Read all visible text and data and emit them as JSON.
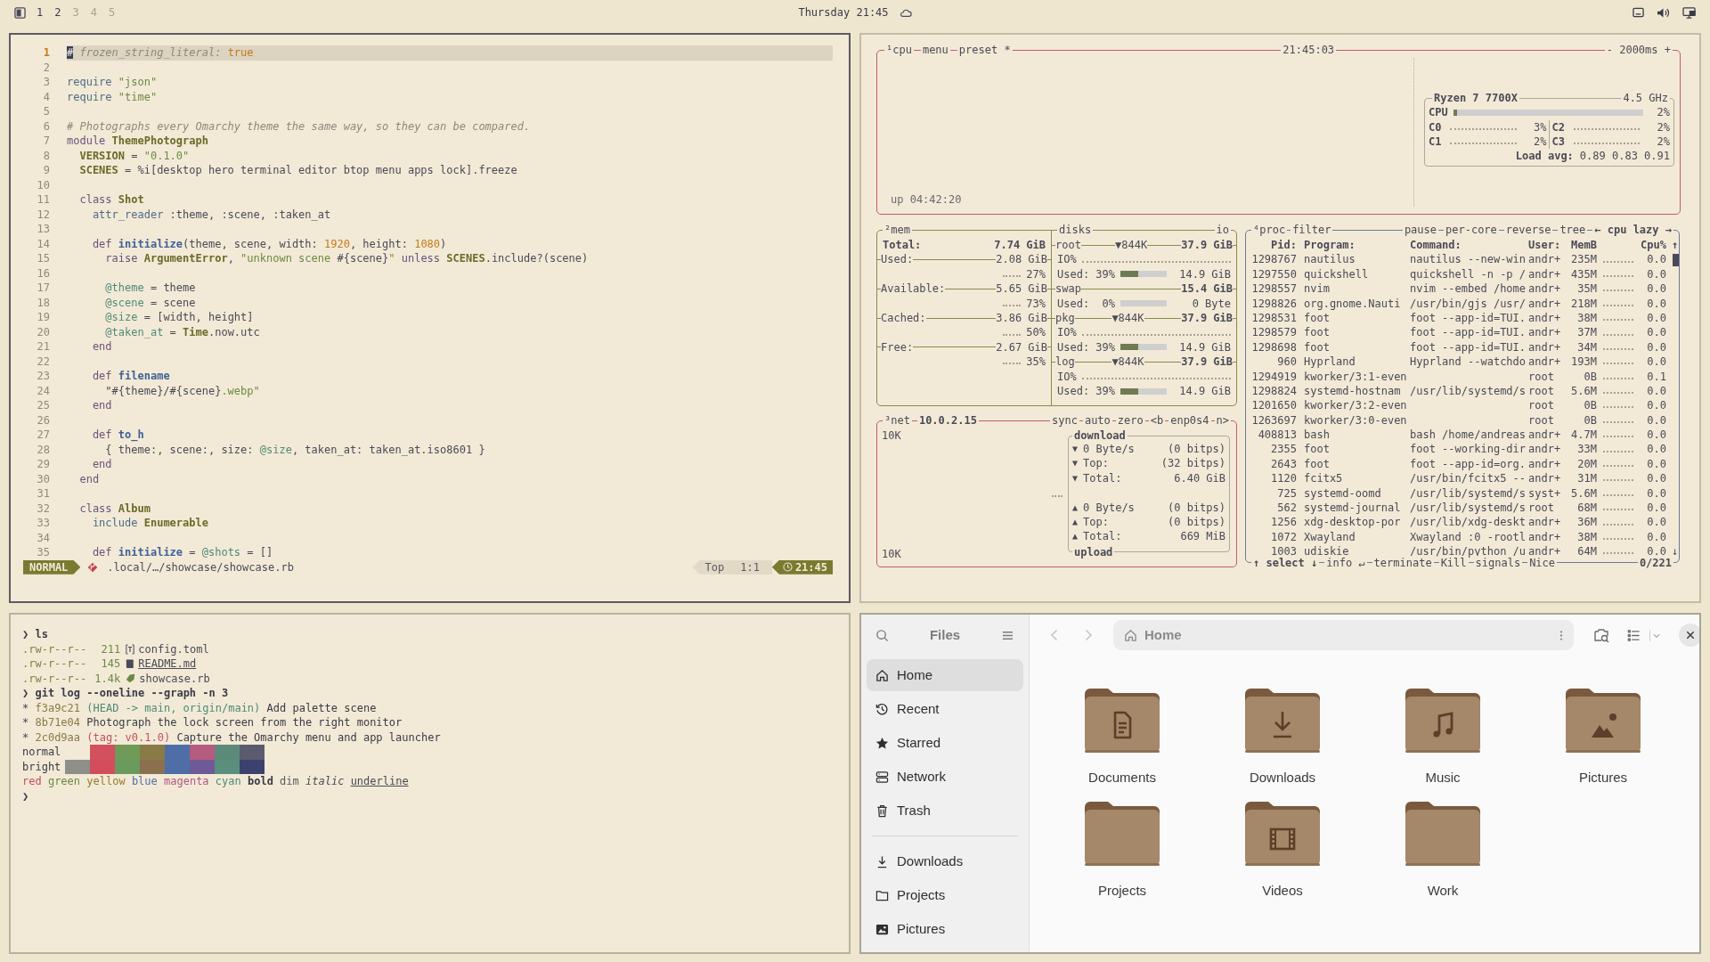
{
  "top_bar": {
    "workspaces": [
      {
        "label": "1",
        "occupied": true
      },
      {
        "label": "2",
        "occupied": true
      },
      {
        "label": "3",
        "occupied": false
      },
      {
        "label": "4",
        "occupied": false
      },
      {
        "label": "5",
        "occupied": false
      }
    ],
    "clock": "Thursday 21:45"
  },
  "editor": {
    "lines": [
      {
        "number": "1",
        "selected": true,
        "segments": [
          {
            "text": "#",
            "kind": "cursor"
          },
          {
            "text": " frozen_string_literal: ",
            "kind": "comment"
          },
          {
            "text": "true",
            "kind": "number"
          }
        ]
      },
      {
        "number": "2",
        "selected": false
      },
      {
        "number": "3",
        "selected": false,
        "segments": [
          {
            "text": "require",
            "kind": "builtin"
          },
          {
            "text": " \"json\"",
            "kind": "string"
          }
        ]
      },
      {
        "number": "4",
        "selected": false,
        "segments": [
          {
            "text": "require",
            "kind": "builtin"
          },
          {
            "text": " \"time\"",
            "kind": "string"
          }
        ]
      },
      {
        "number": "5",
        "selected": false
      },
      {
        "number": "6",
        "selected": false,
        "segments": [
          {
            "text": "# Photographs every Omarchy theme the same way, so they can be compared.",
            "kind": "comment"
          }
        ]
      },
      {
        "number": "7",
        "selected": false,
        "segments": [
          {
            "text": "module",
            "kind": "keyword"
          },
          {
            "text": " ThemePhotograph",
            "kind": "const"
          }
        ]
      },
      {
        "number": "8",
        "selected": false,
        "segments": [
          {
            "text": "  VERSION",
            "kind": "const"
          },
          {
            "text": " = ",
            "kind": "plain"
          },
          {
            "text": "\"0.1.0\"",
            "kind": "string"
          }
        ]
      },
      {
        "number": "9",
        "selected": false,
        "segments": [
          {
            "text": "  SCENES",
            "kind": "const"
          },
          {
            "text": " = %i[desktop hero terminal editor btop menu apps lock].freeze",
            "kind": "plain"
          }
        ]
      },
      {
        "number": "10",
        "selected": false
      },
      {
        "number": "11",
        "selected": false,
        "segments": [
          {
            "text": "  class",
            "kind": "keyword"
          },
          {
            "text": " Shot",
            "kind": "const"
          }
        ]
      },
      {
        "number": "12",
        "selected": false,
        "segments": [
          {
            "text": "    attr_reader",
            "kind": "builtin"
          },
          {
            "text": " :theme, :scene, :taken_at",
            "kind": "plain"
          }
        ]
      },
      {
        "number": "13",
        "selected": false
      },
      {
        "number": "14",
        "selected": false,
        "segments": [
          {
            "text": "    def",
            "kind": "keyword"
          },
          {
            "text": " initialize",
            "kind": "func"
          },
          {
            "text": "(theme, scene, width: ",
            "kind": "plain"
          },
          {
            "text": "1920",
            "kind": "number"
          },
          {
            "text": ", height: ",
            "kind": "plain"
          },
          {
            "text": "1080",
            "kind": "number"
          },
          {
            "text": ")",
            "kind": "plain"
          }
        ]
      },
      {
        "number": "15",
        "selected": false,
        "segments": [
          {
            "text": "      raise",
            "kind": "keyword"
          },
          {
            "text": " ArgumentError",
            "kind": "const"
          },
          {
            "text": ", ",
            "kind": "plain"
          },
          {
            "text": "\"unknown scene ",
            "kind": "string"
          },
          {
            "text": "#{scene}",
            "kind": "plain"
          },
          {
            "text": "\"",
            "kind": "string"
          },
          {
            "text": " unless",
            "kind": "keyword"
          },
          {
            "text": " SCENES",
            "kind": "const"
          },
          {
            "text": ".include?(scene)",
            "kind": "plain"
          }
        ]
      },
      {
        "number": "16",
        "selected": false
      },
      {
        "number": "17",
        "selected": false,
        "segments": [
          {
            "text": "      @theme",
            "kind": "ivar"
          },
          {
            "text": " = theme",
            "kind": "plain"
          }
        ]
      },
      {
        "number": "18",
        "selected": false,
        "segments": [
          {
            "text": "      @scene",
            "kind": "ivar"
          },
          {
            "text": " = scene",
            "kind": "plain"
          }
        ]
      },
      {
        "number": "19",
        "selected": false,
        "segments": [
          {
            "text": "      @size",
            "kind": "ivar"
          },
          {
            "text": " = [width, height]",
            "kind": "plain"
          }
        ]
      },
      {
        "number": "20",
        "selected": false,
        "segments": [
          {
            "text": "      @taken_at",
            "kind": "ivar"
          },
          {
            "text": " = ",
            "kind": "plain"
          },
          {
            "text": "Time",
            "kind": "const"
          },
          {
            "text": ".now.utc",
            "kind": "plain"
          }
        ]
      },
      {
        "number": "21",
        "selected": false,
        "segments": [
          {
            "text": "    end",
            "kind": "keyword"
          }
        ]
      },
      {
        "number": "22",
        "selected": false
      },
      {
        "number": "23",
        "selected": false,
        "segments": [
          {
            "text": "    def",
            "kind": "keyword"
          },
          {
            "text": " filename",
            "kind": "func"
          }
        ]
      },
      {
        "number": "24",
        "selected": false,
        "segments": [
          {
            "text": "      \"#{theme}/#{scene}",
            "kind": "plain"
          },
          {
            "text": ".webp\"",
            "kind": "string"
          }
        ]
      },
      {
        "number": "25",
        "selected": false,
        "segments": [
          {
            "text": "    end",
            "kind": "keyword"
          }
        ]
      },
      {
        "number": "26",
        "selected": false
      },
      {
        "number": "27",
        "selected": false,
        "segments": [
          {
            "text": "    def",
            "kind": "keyword"
          },
          {
            "text": " to_h",
            "kind": "func"
          }
        ]
      },
      {
        "number": "28",
        "selected": false,
        "segments": [
          {
            "text": "      { theme:, scene:, size: ",
            "kind": "plain"
          },
          {
            "text": "@size",
            "kind": "ivar"
          },
          {
            "text": ", taken_at: taken_at.iso8601 }",
            "kind": "plain"
          }
        ]
      },
      {
        "number": "29",
        "selected": false,
        "segments": [
          {
            "text": "    end",
            "kind": "keyword"
          }
        ]
      },
      {
        "number": "30",
        "selected": false,
        "segments": [
          {
            "text": "  end",
            "kind": "keyword"
          }
        ]
      },
      {
        "number": "31",
        "selected": false
      },
      {
        "number": "32",
        "selected": false,
        "segments": [
          {
            "text": "  class",
            "kind": "keyword"
          },
          {
            "text": " Album",
            "kind": "const"
          }
        ]
      },
      {
        "number": "33",
        "selected": false,
        "segments": [
          {
            "text": "    include",
            "kind": "builtin"
          },
          {
            "text": " Enumerable",
            "kind": "const"
          }
        ]
      },
      {
        "number": "34",
        "selected": false
      },
      {
        "number": "35",
        "selected": false,
        "segments": [
          {
            "text": "    def",
            "kind": "keyword"
          },
          {
            "text": " initialize",
            "kind": "func"
          },
          {
            "text": " = ",
            "kind": "plain"
          },
          {
            "text": "@shots",
            "kind": "ivar"
          },
          {
            "text": " = []",
            "kind": "plain"
          }
        ]
      }
    ],
    "status": {
      "mode": "NORMAL",
      "file": ".local/…/showcase/showcase.rb",
      "position": "Top",
      "cursor": "1:1",
      "time": "21:45"
    }
  },
  "terminal": {
    "lines": [
      {
        "kind": "prompt",
        "prompt": "❯",
        "command": "ls"
      },
      {
        "kind": "file",
        "perms": ".rw-r--r--",
        "size": "211",
        "name": "config.toml",
        "underline": false
      },
      {
        "kind": "file",
        "perms": ".rw-r--r--",
        "size": "145",
        "name": "README.md",
        "underline": true
      },
      {
        "kind": "file",
        "perms": ".rw-r--r--",
        "size": "1.4k",
        "name": "showcase.rb",
        "underline": false
      },
      {
        "kind": "prompt",
        "prompt": "❯",
        "command": "git log --oneline --graph -n 3"
      },
      {
        "kind": "commit",
        "graph": "*",
        "hash": "f3a9c21",
        "refs": {
          "text": "(HEAD -> main, origin/main)",
          "kind": "branch"
        },
        "message": "Add palette scene"
      },
      {
        "kind": "commit",
        "graph": "*",
        "hash": "8b71e04",
        "message": "Photograph the lock screen from the right monitor"
      },
      {
        "kind": "commit",
        "graph": "*",
        "hash": "2c0d9aa",
        "refs": {
          "text": "(tag: v0.1.0)",
          "kind": "tag"
        },
        "message": "Capture the Omarchy menu and app launcher"
      },
      {
        "kind": "palette",
        "label": "normal",
        "swatches": [
          {
            "color": "#d3505f"
          },
          {
            "color": "#6f9a58"
          },
          {
            "color": "#8a7a45"
          },
          {
            "color": "#4f6ea8"
          },
          {
            "color": "#b45b7f"
          },
          {
            "color": "#5b8a7b"
          },
          {
            "color": "#5a5b6e"
          }
        ]
      },
      {
        "kind": "palette",
        "label": "bright",
        "swatches": [
          {
            "color": "#8f8f8a"
          },
          {
            "color": "#d44d5c"
          },
          {
            "color": "#6b9a5f"
          },
          {
            "color": "#8b7050"
          },
          {
            "color": "#4f6ea8"
          },
          {
            "color": "#6e5a96"
          },
          {
            "color": "#5a8f7e"
          },
          {
            "color": "#3d4170"
          }
        ]
      },
      {
        "kind": "styles",
        "words": [
          {
            "text": "red",
            "kind": "red"
          },
          {
            "text": "green",
            "kind": "green"
          },
          {
            "text": "yellow",
            "kind": "yellow"
          },
          {
            "text": "blue",
            "kind": "blue"
          },
          {
            "text": "magenta",
            "kind": "magenta"
          },
          {
            "text": "cyan",
            "kind": "cyan"
          },
          {
            "text": "bold",
            "kind": "bold"
          },
          {
            "text": "dim",
            "kind": "dim"
          },
          {
            "text": "italic",
            "kind": "italic"
          },
          {
            "text": "underline",
            "kind": "underline"
          }
        ]
      },
      {
        "kind": "prompt",
        "prompt": "❯"
      }
    ]
  },
  "btop": {
    "cpu": {
      "tabs": [
        "¹cpu",
        "menu",
        "preset *"
      ],
      "clock": "21:45:03",
      "interval": "- 2000ms +",
      "uptime": "up 04:42:20",
      "model": "Ryzen 7 7700X",
      "frequency": "4.5 GHz",
      "total": {
        "label": "CPU",
        "level": 0.02,
        "value": "2%"
      },
      "cores": [
        {
          "label": "C0",
          "value": "3%"
        },
        {
          "label": "C1",
          "value": "2%"
        },
        {
          "label": "C2",
          "value": "2%"
        },
        {
          "label": "C3",
          "value": "2%"
        }
      ],
      "load_label": "Load avg:",
      "load": "0.89 0.83 0.91"
    },
    "memory": {
      "title": "²mem",
      "total": {
        "label": "Total:",
        "value": "7.74 GiB"
      },
      "rows": [
        {
          "label": "Used:",
          "value": "2.08 GiB",
          "percent": "27%"
        },
        {
          "label": "Available:",
          "value": "5.65 GiB",
          "percent": "73%"
        },
        {
          "label": "Cached:",
          "value": "3.86 GiB",
          "percent": "50%"
        },
        {
          "label": "Free:",
          "value": "2.67 GiB",
          "percent": "35%"
        }
      ]
    },
    "disks": {
      "title": "disks",
      "io_title": "io",
      "items": [
        {
          "name": "root",
          "io": "▼844K",
          "size": "37.9 GiB",
          "io_label": "IO%",
          "used": "Used: 39%",
          "level": 0.39,
          "used_size": "14.9 GiB"
        },
        {
          "name": "swap",
          "size": "15.4 GiB",
          "used": "Used:  0%",
          "level": 0,
          "used_size": "0 Byte"
        },
        {
          "name": "pkg",
          "io": "▼844K",
          "size": "37.9 GiB",
          "io_label": "IO%",
          "used": "Used: 39%",
          "level": 0.39,
          "used_size": "14.9 GiB"
        },
        {
          "name": "log",
          "io": "▼844K",
          "size": "37.9 GiB",
          "io_label": "IO%",
          "used": "Used: 39%",
          "level": 0.39,
          "used_size": "14.9 GiB"
        }
      ]
    },
    "net": {
      "title": "³net",
      "address": "10.0.2.15",
      "options": [
        "sync",
        "auto",
        "zero",
        "<b",
        "enp0s4",
        "n>"
      ],
      "scale_top": "10K",
      "scale_bottom": "10K",
      "download": {
        "title": "download",
        "rows": [
          {
            "arrow": "▼",
            "label": "0 Byte/s",
            "value": "(0 bitps)"
          },
          {
            "arrow": "▼",
            "label": "Top:",
            "value": "(32 bitps)"
          },
          {
            "arrow": "▼",
            "label": "Total:",
            "value": "6.40 GiB"
          }
        ]
      },
      "upload": {
        "title": "upload",
        "rows": [
          {
            "arrow": "▲",
            "label": "0 Byte/s",
            "value": "(0 bitps)"
          },
          {
            "arrow": "▲",
            "label": "Top:",
            "value": "(0 bitps)"
          },
          {
            "arrow": "▲",
            "label": "Total:",
            "value": "669 MiB"
          }
        ]
      }
    },
    "proc": {
      "title": "⁴proc",
      "filter": "filter",
      "options": [
        "pause",
        "per-core",
        "reverse",
        "tree"
      ],
      "sort": "← cpu lazy →",
      "columns": [
        "Pid:",
        "Program:",
        "Command:",
        "User:",
        "MemB",
        "Cpu%"
      ],
      "scroll_up": "↑",
      "scroll_down": "↓",
      "rows": [
        {
          "pid": "1298767",
          "program": "nautilus",
          "command": "nautilus --new-win",
          "user": "andr+",
          "mem": "235M",
          "cpu": "0.0"
        },
        {
          "pid": "1297550",
          "program": "quickshell",
          "command": "quickshell -n -p /",
          "user": "andr+",
          "mem": "435M",
          "cpu": "0.0"
        },
        {
          "pid": "1298557",
          "program": "nvim",
          "command": "nvim --embed /home",
          "user": "andr+",
          "mem": "35M",
          "cpu": "0.0"
        },
        {
          "pid": "1298826",
          "program": "org.gnome.Nauti",
          "command": "/usr/bin/gjs /usr/",
          "user": "andr+",
          "mem": "218M",
          "cpu": "0.0"
        },
        {
          "pid": "1298531",
          "program": "foot",
          "command": "foot --app-id=TUI.",
          "user": "andr+",
          "mem": "38M",
          "cpu": "0.0"
        },
        {
          "pid": "1298579",
          "program": "foot",
          "command": "foot --app-id=TUI.",
          "user": "andr+",
          "mem": "37M",
          "cpu": "0.0"
        },
        {
          "pid": "1298698",
          "program": "foot",
          "command": "foot --app-id=TUI.",
          "user": "andr+",
          "mem": "34M",
          "cpu": "0.0"
        },
        {
          "pid": "960",
          "program": "Hyprland",
          "command": "Hyprland --watchdo",
          "user": "andr+",
          "mem": "193M",
          "cpu": "0.0"
        },
        {
          "pid": "1294919",
          "program": "kworker/3:1-even",
          "user": "root",
          "mem": "0B",
          "cpu": "0.1"
        },
        {
          "pid": "1298824",
          "program": "systemd-hostnam",
          "command": "/usr/lib/systemd/s",
          "user": "root",
          "mem": "5.6M",
          "cpu": "0.0"
        },
        {
          "pid": "1201650",
          "program": "kworker/3:2-even",
          "user": "root",
          "mem": "0B",
          "cpu": "0.0"
        },
        {
          "pid": "1263697",
          "program": "kworker/3:0-even",
          "user": "root",
          "mem": "0B",
          "cpu": "0.0"
        },
        {
          "pid": "408813",
          "program": "bash",
          "command": "bash /home/andreas",
          "user": "andr+",
          "mem": "4.7M",
          "cpu": "0.0"
        },
        {
          "pid": "2355",
          "program": "foot",
          "command": "foot --working-dir",
          "user": "andr+",
          "mem": "33M",
          "cpu": "0.0"
        },
        {
          "pid": "2643",
          "program": "foot",
          "command": "foot --app-id=org.",
          "user": "andr+",
          "mem": "20M",
          "cpu": "0.0"
        },
        {
          "pid": "1120",
          "program": "fcitx5",
          "command": "/usr/bin/fcitx5 --",
          "user": "andr+",
          "mem": "31M",
          "cpu": "0.0"
        },
        {
          "pid": "725",
          "program": "systemd-oomd",
          "command": "/usr/lib/systemd/s",
          "user": "syst+",
          "mem": "5.6M",
          "cpu": "0.0"
        },
        {
          "pid": "562",
          "program": "systemd-journal",
          "command": "/usr/lib/systemd/s",
          "user": "root",
          "mem": "68M",
          "cpu": "0.0"
        },
        {
          "pid": "1256",
          "program": "xdg-desktop-por",
          "command": "/usr/lib/xdg-deskt",
          "user": "andr+",
          "mem": "36M",
          "cpu": "0.0"
        },
        {
          "pid": "1072",
          "program": "Xwayland",
          "command": "Xwayland :0 -rootl",
          "user": "andr+",
          "mem": "38M",
          "cpu": "0.0"
        },
        {
          "pid": "1003",
          "program": "udiskie",
          "command": "/usr/bin/python /u",
          "user": "andr+",
          "mem": "64M",
          "cpu": "0.0"
        }
      ],
      "footer": [
        "↑ select ↓",
        "info ↵",
        "terminate",
        "Kill",
        "signals",
        "Nice"
      ],
      "count": "0/221"
    }
  },
  "files": {
    "title": "Files",
    "places": [
      {
        "label": "Home",
        "kind": "home",
        "selected": true
      },
      {
        "label": "Recent",
        "kind": "clock",
        "selected": false
      },
      {
        "label": "Starred",
        "kind": "star",
        "selected": false
      },
      {
        "label": "Network",
        "kind": "network",
        "selected": false
      },
      {
        "label": "Trash",
        "kind": "trash",
        "selected": false
      }
    ],
    "bookmarks": [
      {
        "label": "Downloads",
        "kind": "download",
        "selected": false
      },
      {
        "label": "Projects",
        "kind": "folder",
        "selected": false
      },
      {
        "label": "Pictures",
        "kind": "image",
        "selected": false
      }
    ],
    "nav": [
      {
        "kind": "back",
        "disabled": true
      },
      {
        "kind": "forward",
        "disabled": true
      }
    ],
    "path": "Home",
    "folders": [
      {
        "name": "Documents",
        "kind": "document"
      },
      {
        "name": "Downloads",
        "kind": "download"
      },
      {
        "name": "Music",
        "kind": "music"
      },
      {
        "name": "Pictures",
        "kind": "image"
      },
      {
        "name": "Projects",
        "kind": "none"
      },
      {
        "name": "Videos",
        "kind": "film"
      },
      {
        "name": "Work",
        "kind": "none"
      }
    ]
  }
}
